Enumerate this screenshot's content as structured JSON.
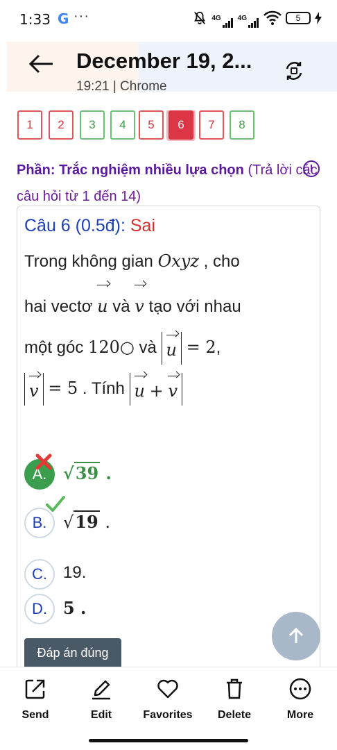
{
  "status_bar": {
    "time": "1:33",
    "google_badge": "G",
    "more_dots": "···",
    "network_1": "4G",
    "network_2": "4G",
    "battery": "5"
  },
  "header": {
    "title": "December 19, 2...",
    "subtitle": "19:21 | Chrome",
    "icons": [
      "back-arrow-icon",
      "screen-rotate-icon"
    ]
  },
  "question_nav": [
    {
      "label": "1",
      "state": "wrong"
    },
    {
      "label": "2",
      "state": "wrong"
    },
    {
      "label": "3",
      "state": "right"
    },
    {
      "label": "4",
      "state": "right"
    },
    {
      "label": "5",
      "state": "wrong"
    },
    {
      "label": "6",
      "state": "active"
    },
    {
      "label": "7",
      "state": "wrong"
    },
    {
      "label": "8",
      "state": "right"
    }
  ],
  "section": {
    "title": "Phần: Trắc nghiệm nhiều lựa chọn",
    "note": "(Trả lời các câu hỏi từ 1 đến 14)",
    "info_icon": "!"
  },
  "question": {
    "label": "Câu 6 (0.5đ):",
    "status": "Sai",
    "line1_a": "Trong không gian",
    "line1_math": "Oxyz",
    "line1_b": ", cho",
    "line2_a": "hai vectơ",
    "line2_u": "u",
    "line2_and": "và",
    "line2_v": "v",
    "line2_b": "tạo với nhau",
    "line3_a": "một góc",
    "line3_angle": "120○",
    "line3_and": "và",
    "line3_u": "u",
    "line3_eq": "= 2",
    "line3_comma": ",",
    "line4_v": "v",
    "line4_eq": "= 5",
    "line4_tinh": ". Tính",
    "line4_u": "u",
    "line4_plus": "+",
    "line4_v2": "v"
  },
  "options": [
    {
      "letter": "A.",
      "radicand": "39",
      "suffix": ".",
      "selected": true,
      "mark": "wrong"
    },
    {
      "letter": "B.",
      "radicand": "19",
      "suffix": ".",
      "correct": true,
      "mark": "right"
    },
    {
      "letter": "C.",
      "text": "19."
    },
    {
      "letter": "D.",
      "text": "5 ."
    }
  ],
  "answer_button": "Đáp án đúng",
  "bottom_bar": [
    {
      "label": "Send",
      "icon": "share-icon"
    },
    {
      "label": "Edit",
      "icon": "pencil-icon"
    },
    {
      "label": "Favorites",
      "icon": "heart-icon"
    },
    {
      "label": "Delete",
      "icon": "trash-icon"
    },
    {
      "label": "More",
      "icon": "more-dots-icon"
    }
  ],
  "colors": {
    "accent_red": "#dc3545",
    "correct_green": "#3a9e4d",
    "question_blue": "#1e3fb5",
    "section_purple": "#5b1a9d"
  }
}
